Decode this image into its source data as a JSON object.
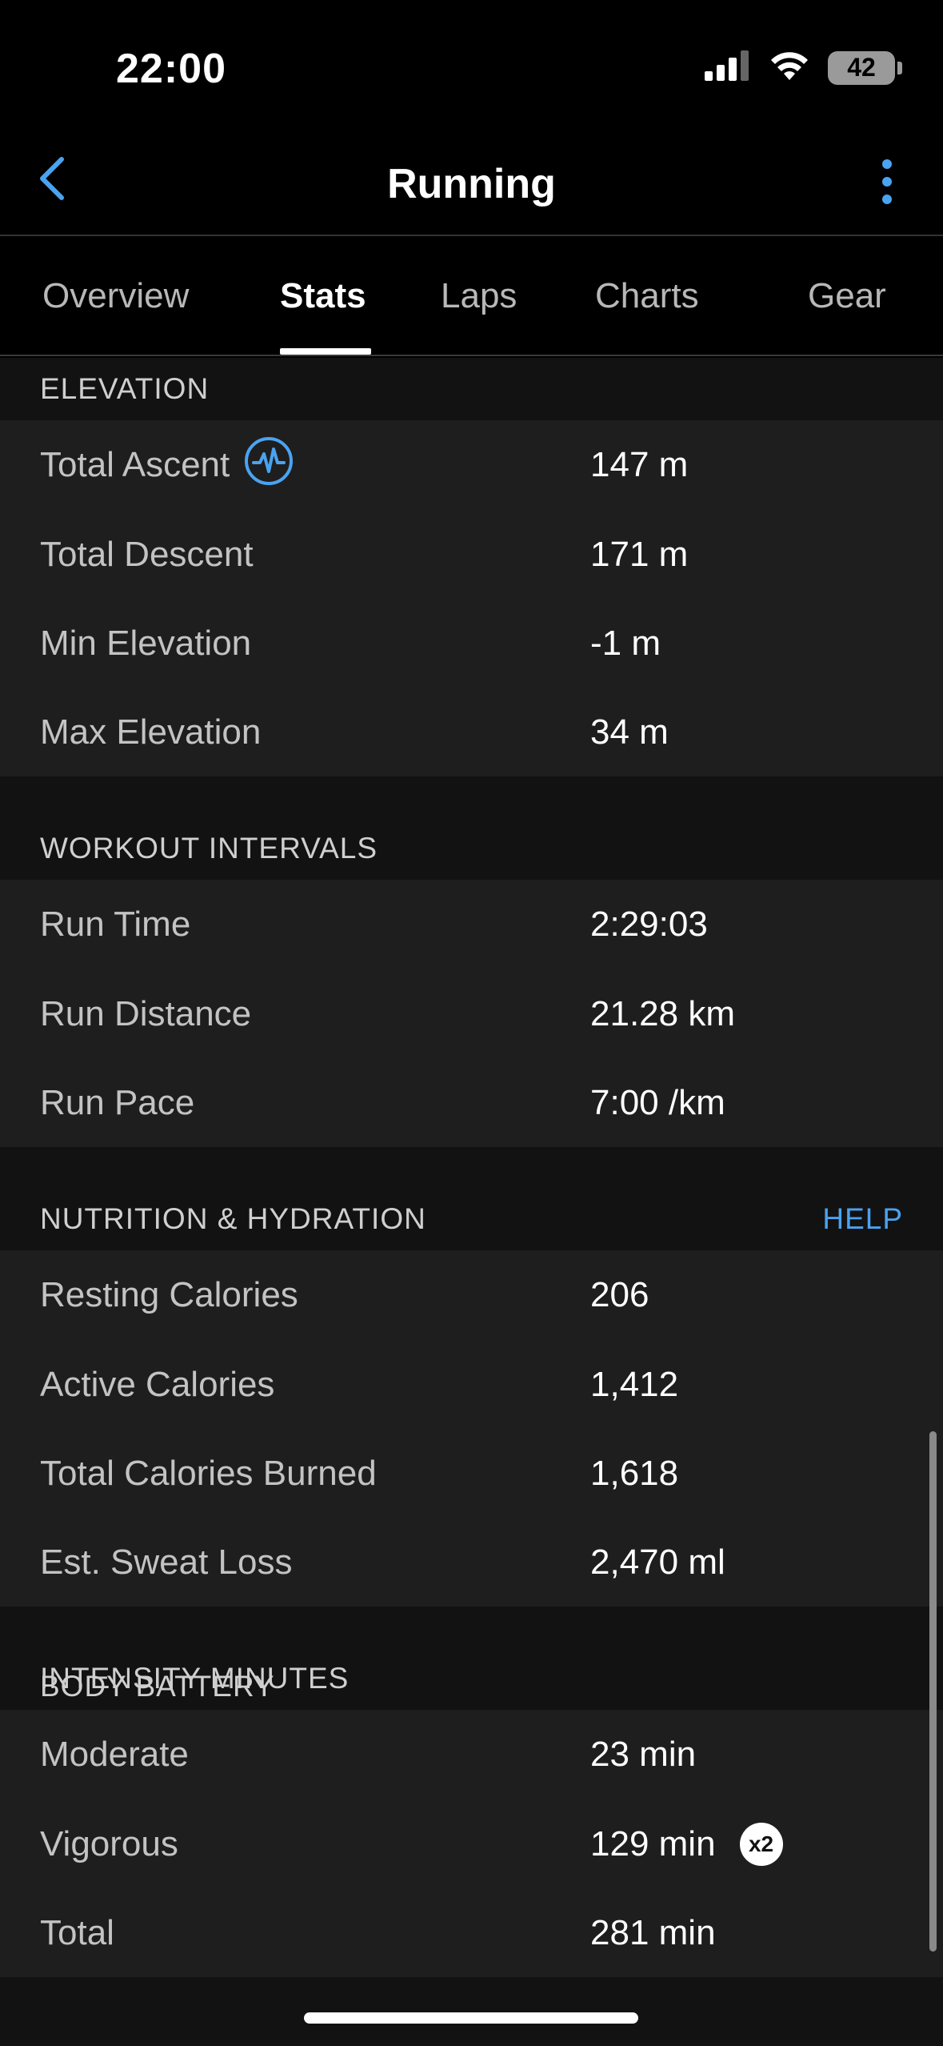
{
  "status": {
    "time": "22:00",
    "battery": "42"
  },
  "nav": {
    "title": "Running"
  },
  "tabs": [
    {
      "label": "Overview"
    },
    {
      "label": "Stats"
    },
    {
      "label": "Laps"
    },
    {
      "label": "Charts"
    },
    {
      "label": "Gear"
    }
  ],
  "sections": {
    "elevation": {
      "title": "ELEVATION",
      "rows": [
        {
          "label": "Total Ascent",
          "value": "147 m"
        },
        {
          "label": "Total Descent",
          "value": "171 m"
        },
        {
          "label": "Min Elevation",
          "value": "-1 m"
        },
        {
          "label": "Max Elevation",
          "value": "34 m"
        }
      ]
    },
    "workout_intervals": {
      "title": "WORKOUT INTERVALS",
      "rows": [
        {
          "label": "Run Time",
          "value": "2:29:03"
        },
        {
          "label": "Run Distance",
          "value": "21.28 km"
        },
        {
          "label": "Run Pace",
          "value": "7:00 /km"
        }
      ]
    },
    "nutrition": {
      "title": "NUTRITION & HYDRATION",
      "help": "HELP",
      "rows": [
        {
          "label": "Resting Calories",
          "value": "206"
        },
        {
          "label": "Active Calories",
          "value": "1,412"
        },
        {
          "label": "Total Calories Burned",
          "value": "1,618"
        },
        {
          "label": "Est. Sweat Loss",
          "value": "2,470 ml"
        }
      ]
    },
    "intensity": {
      "title": "INTENSITY MINUTES",
      "rows": [
        {
          "label": "Moderate",
          "value": "23 min"
        },
        {
          "label": "Vigorous",
          "value": "129 min",
          "badge": "x2"
        },
        {
          "label": "Total",
          "value": "281 min"
        }
      ]
    },
    "body_battery": {
      "title": "BODY BATTERY"
    }
  },
  "colors": {
    "accent": "#4aa3f0",
    "background": "#121212",
    "row_background": "#1e1e1e"
  }
}
